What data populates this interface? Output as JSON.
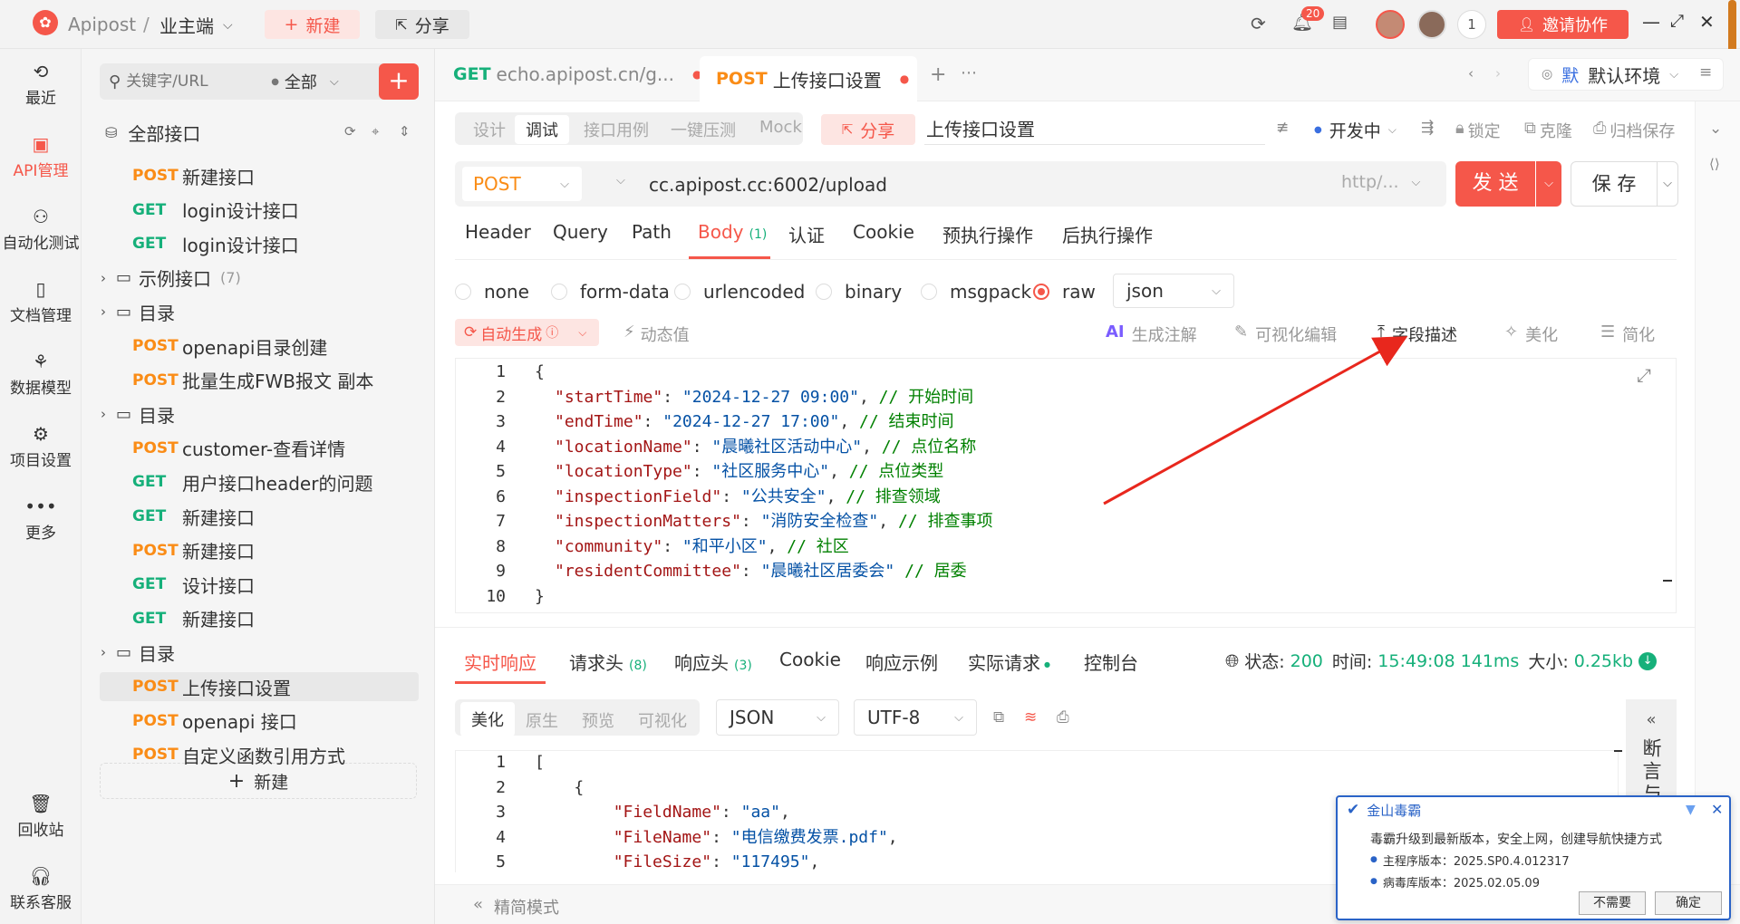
{
  "app": {
    "name": "Apipost",
    "breadcrumb_sep": "/",
    "project": "业主端"
  },
  "topbar": {
    "new_label": "新建",
    "share_label": "分享",
    "notif_count": "20",
    "online_count": "1",
    "invite_label": "邀请协作"
  },
  "rail": {
    "items": [
      {
        "label": "最近",
        "icon": "clock-icon"
      },
      {
        "label": "API管理",
        "icon": "api-icon"
      },
      {
        "label": "自动化测试",
        "icon": "flow-icon"
      },
      {
        "label": "文档管理",
        "icon": "doc-icon"
      },
      {
        "label": "数据模型",
        "icon": "model-icon"
      },
      {
        "label": "项目设置",
        "icon": "settings-icon"
      },
      {
        "label": "更多",
        "icon": "more-icon"
      }
    ],
    "trash": "回收站",
    "support": "联系客服"
  },
  "sidebar": {
    "search_placeholder": "关键字/URL",
    "filter": "全部",
    "root": "全部接口",
    "tree": [
      {
        "method": "POST",
        "name": "新建接口"
      },
      {
        "method": "GET",
        "name": "login设计接口"
      },
      {
        "method": "GET",
        "name": "login设计接口"
      },
      {
        "folder": true,
        "name": "示例接口",
        "count": "(7)"
      },
      {
        "folder": true,
        "name": "目录"
      },
      {
        "method": "POST",
        "name": "openapi目录创建"
      },
      {
        "method": "POST",
        "name": "批量生成FWB报文 副本"
      },
      {
        "folder": true,
        "name": "目录"
      },
      {
        "method": "POST",
        "name": "customer-查看详情"
      },
      {
        "method": "GET",
        "name": "用户接口header的问题"
      },
      {
        "method": "GET",
        "name": "新建接口"
      },
      {
        "method": "POST",
        "name": "新建接口"
      },
      {
        "method": "GET",
        "name": "设计接口"
      },
      {
        "method": "GET",
        "name": "新建接口"
      },
      {
        "folder": true,
        "name": "目录"
      },
      {
        "method": "POST",
        "name": "上传接口设置"
      },
      {
        "method": "POST",
        "name": "openapi 接口"
      },
      {
        "method": "POST",
        "name": "自定义函数引用方式"
      }
    ],
    "new_label": "新建"
  },
  "tabs": [
    {
      "method": "GET",
      "title": "echo.apipost.cn/g..."
    },
    {
      "method": "POST",
      "title": "上传接口设置"
    }
  ],
  "env": {
    "badge": "默",
    "label": "默认环境"
  },
  "modes": [
    "设计",
    "调试",
    "接口用例",
    "一键压测",
    "Mock"
  ],
  "share_label": "分享",
  "api_name": "上传接口设置",
  "status": {
    "label": "开发中",
    "lock": "锁定",
    "clone": "克隆",
    "archive": "归档保存"
  },
  "request": {
    "method": "POST",
    "url": "cc.apipost.cc:6002/upload",
    "protocol": "http/...",
    "send": "发 送",
    "save": "保 存"
  },
  "req_tabs": [
    "Header",
    "Query",
    "Path",
    "Body",
    "认证",
    "Cookie",
    "预执行操作",
    "后执行操作"
  ],
  "body_count": "(1)",
  "body_types": [
    "none",
    "form-data",
    "urlencoded",
    "binary",
    "msgpack",
    "raw"
  ],
  "raw_format": "json",
  "tools": {
    "autogen": "自动生成",
    "dynamic": "动态值",
    "ai": "生成注解",
    "visual": "可视化编辑",
    "field_desc": "字段描述",
    "beautify": "美化",
    "simplify": "简化"
  },
  "body_code": [
    [
      [
        "p",
        "{"
      ]
    ],
    [
      [
        "k",
        "\"startTime\""
      ],
      [
        "p",
        ": "
      ],
      [
        "s",
        "\"2024-12-27 09:00\""
      ],
      [
        "p",
        ", "
      ],
      [
        "c",
        "// 开始时间"
      ]
    ],
    [
      [
        "k",
        "\"endTime\""
      ],
      [
        "p",
        ": "
      ],
      [
        "s",
        "\"2024-12-27 17:00\""
      ],
      [
        "p",
        ", "
      ],
      [
        "c",
        "// 结束时间"
      ]
    ],
    [
      [
        "k",
        "\"locationName\""
      ],
      [
        "p",
        ": "
      ],
      [
        "s",
        "\"晨曦社区活动中心\""
      ],
      [
        "p",
        ", "
      ],
      [
        "c",
        "// 点位名称"
      ]
    ],
    [
      [
        "k",
        "\"locationType\""
      ],
      [
        "p",
        ": "
      ],
      [
        "s",
        "\"社区服务中心\""
      ],
      [
        "p",
        ", "
      ],
      [
        "c",
        "// 点位类型"
      ]
    ],
    [
      [
        "k",
        "\"inspectionField\""
      ],
      [
        "p",
        ": "
      ],
      [
        "s",
        "\"公共安全\""
      ],
      [
        "p",
        ", "
      ],
      [
        "c",
        "// 排查领域"
      ]
    ],
    [
      [
        "k",
        "\"inspectionMatters\""
      ],
      [
        "p",
        ": "
      ],
      [
        "s",
        "\"消防安全检查\""
      ],
      [
        "p",
        ", "
      ],
      [
        "c",
        "// 排查事项"
      ]
    ],
    [
      [
        "k",
        "\"community\""
      ],
      [
        "p",
        ": "
      ],
      [
        "s",
        "\"和平小区\""
      ],
      [
        "p",
        ", "
      ],
      [
        "c",
        "// 社区"
      ]
    ],
    [
      [
        "k",
        "\"residentCommittee\""
      ],
      [
        "p",
        ": "
      ],
      [
        "s",
        "\"晨曦社区居委会\""
      ],
      [
        "p",
        " "
      ],
      [
        "c",
        "// 居委"
      ]
    ],
    [
      [
        "p",
        "}"
      ]
    ]
  ],
  "resp_tabs": [
    {
      "label": "实时响应"
    },
    {
      "label": "请求头",
      "count": "(8)"
    },
    {
      "label": "响应头",
      "count": "(3)"
    },
    {
      "label": "Cookie"
    },
    {
      "label": "响应示例"
    },
    {
      "label": "实际请求"
    },
    {
      "label": "控制台"
    }
  ],
  "resp_meta": {
    "status_label": "状态:",
    "status": "200",
    "time_label": "时间:",
    "time": "15:49:08",
    "duration": "141ms",
    "size_label": "大小:",
    "size": "0.25kb"
  },
  "view_modes": [
    "美化",
    "原生",
    "预览",
    "可视化"
  ],
  "resp_format": "JSON",
  "resp_encoding": "UTF-8",
  "resp_code": [
    [
      [
        "p",
        "["
      ]
    ],
    [
      [
        "p",
        "    {"
      ]
    ],
    [
      [
        "p",
        "        "
      ],
      [
        "k",
        "\"FieldName\""
      ],
      [
        "p",
        ": "
      ],
      [
        "s",
        "\"aa\""
      ],
      [
        "p",
        ","
      ]
    ],
    [
      [
        "p",
        "        "
      ],
      [
        "k",
        "\"FileName\""
      ],
      [
        "p",
        ": "
      ],
      [
        "s",
        "\"电信缴费发票.pdf\""
      ],
      [
        "p",
        ","
      ]
    ],
    [
      [
        "p",
        "        "
      ],
      [
        "k",
        "\"FileSize\""
      ],
      [
        "p",
        ": "
      ],
      [
        "s",
        "\"117495\""
      ],
      [
        "p",
        ","
      ]
    ]
  ],
  "assert_panel": "断言与",
  "footer": "精简模式",
  "popup": {
    "title": "金山毒霸",
    "message": "毒霸升级到最新版本，安全上网，创建导航快捷方式",
    "lines": [
      "主程序版本：2025.SP0.4.012317",
      "病毒库版本：2025.02.05.09"
    ],
    "dismiss": "不需要",
    "confirm": "确定"
  },
  "colors": {
    "accent": "#f5574a",
    "post": "#fa8c16",
    "get": "#16b07a",
    "status_ok": "#16b07a"
  }
}
